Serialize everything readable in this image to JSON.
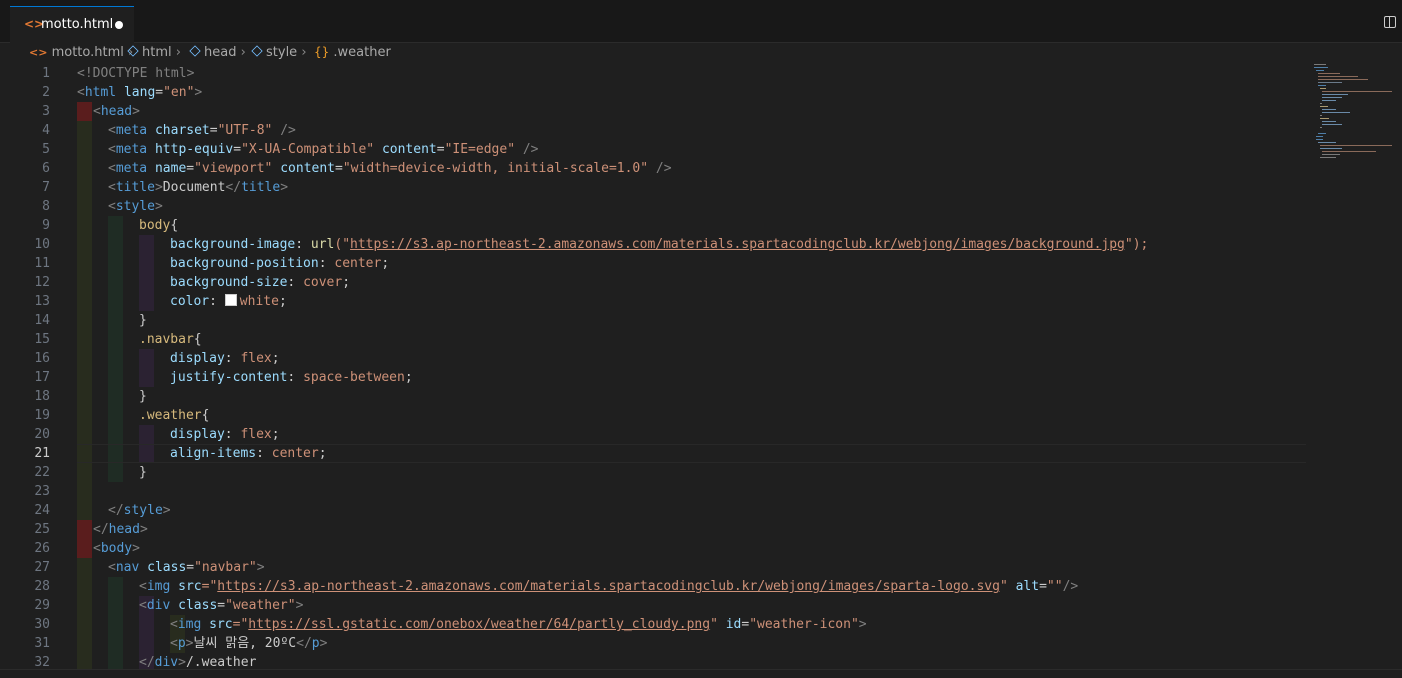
{
  "tab": {
    "title": "motto.html",
    "icon": "html-file-icon"
  },
  "breadcrumb": {
    "file": "motto.html",
    "items": [
      "html",
      "head",
      "style"
    ],
    "last": ".weather"
  },
  "editor": {
    "active_line": 21
  },
  "lines": [
    {
      "n": "1"
    },
    {
      "n": "2"
    },
    {
      "n": "3"
    },
    {
      "n": "4"
    },
    {
      "n": "5"
    },
    {
      "n": "6"
    },
    {
      "n": "7"
    },
    {
      "n": "8"
    },
    {
      "n": "9"
    },
    {
      "n": "10"
    },
    {
      "n": "11"
    },
    {
      "n": "12"
    },
    {
      "n": "13"
    },
    {
      "n": "14"
    },
    {
      "n": "15"
    },
    {
      "n": "16"
    },
    {
      "n": "17"
    },
    {
      "n": "18"
    },
    {
      "n": "19"
    },
    {
      "n": "20"
    },
    {
      "n": "21"
    },
    {
      "n": "22"
    },
    {
      "n": "23"
    },
    {
      "n": "24"
    },
    {
      "n": "25"
    },
    {
      "n": "26"
    },
    {
      "n": "27"
    },
    {
      "n": "28"
    },
    {
      "n": "29"
    },
    {
      "n": "30"
    },
    {
      "n": "31"
    },
    {
      "n": "32"
    }
  ],
  "code": {
    "l1": {
      "a": "<!DOCTYPE html>"
    },
    "l2": {
      "a": "<",
      "b": "html",
      "c": " lang",
      "d": "=",
      "e": "\"en\"",
      "f": ">"
    },
    "l3": {
      "a": "<",
      "b": "head",
      "c": ">"
    },
    "l4": {
      "a": "<",
      "b": "meta",
      "c": " charset",
      "d": "=",
      "e": "\"UTF-8\"",
      "f": " />"
    },
    "l5": {
      "a": "<",
      "b": "meta",
      "c": " http-equiv",
      "d": "=",
      "e": "\"X-UA-Compatible\"",
      "f": " content",
      "g": "=",
      "h": "\"IE=edge\"",
      "i": " />"
    },
    "l6": {
      "a": "<",
      "b": "meta",
      "c": " name",
      "d": "=",
      "e": "\"viewport\"",
      "f": " content",
      "g": "=",
      "h": "\"width=device-width, initial-scale=1.0\"",
      "i": " />"
    },
    "l7": {
      "a": "<",
      "b": "title",
      "c": ">",
      "d": "Document",
      "e": "</",
      "f": "title",
      "g": ">"
    },
    "l8": {
      "a": "<",
      "b": "style",
      "c": ">"
    },
    "l9": {
      "a": "body",
      "b": "{"
    },
    "l10": {
      "a": "background-image",
      "b": ": ",
      "c": "url",
      "d": "(\"",
      "e": "https://s3.ap-northeast-2.amazonaws.com/materials.spartacodingclub.kr/webjong/images/background.jpg",
      "f": "\");"
    },
    "l11": {
      "a": "background-position",
      "b": ": ",
      "c": "center",
      "d": ";"
    },
    "l12": {
      "a": "background-size",
      "b": ": ",
      "c": "cover",
      "d": ";"
    },
    "l13": {
      "a": "color",
      "b": ": ",
      "c": "white",
      "d": ";"
    },
    "l14": {
      "a": "}"
    },
    "l15": {
      "a": ".navbar",
      "b": "{"
    },
    "l16": {
      "a": "display",
      "b": ": ",
      "c": "flex",
      "d": ";"
    },
    "l17": {
      "a": "justify-content",
      "b": ": ",
      "c": "space-between",
      "d": ";"
    },
    "l18": {
      "a": "}"
    },
    "l19": {
      "a": ".weather",
      "b": "{"
    },
    "l20": {
      "a": "display",
      "b": ": ",
      "c": "flex",
      "d": ";"
    },
    "l21": {
      "a": "align-items",
      "b": ": ",
      "c": "center",
      "d": ";"
    },
    "l22": {
      "a": "}"
    },
    "l24": {
      "a": "</",
      "b": "style",
      "c": ">"
    },
    "l25": {
      "a": "</",
      "b": "head",
      "c": ">"
    },
    "l26": {
      "a": "<",
      "b": "body",
      "c": ">"
    },
    "l27": {
      "a": "<",
      "b": "nav",
      "c": " class",
      "d": "=",
      "e": "\"navbar\"",
      "f": ">"
    },
    "l28": {
      "a": "<",
      "b": "img",
      "c": " src",
      "d": "=\"",
      "e": "https://s3.ap-northeast-2.amazonaws.com/materials.spartacodingclub.kr/webjong/images/sparta-logo.svg",
      "f": "\"",
      "g": " alt",
      "h": "=",
      "i": "\"\"",
      "j": "/>"
    },
    "l29": {
      "a": "<",
      "b": "div",
      "c": " class",
      "d": "=",
      "e": "\"weather\"",
      "f": ">"
    },
    "l30": {
      "a": "<",
      "b": "img",
      "c": " src",
      "d": "=\"",
      "e": "https://ssl.gstatic.com/onebox/weather/64/partly_cloudy.png",
      "f": "\"",
      "g": " id",
      "h": "=",
      "i": "\"weather-icon\"",
      "j": ">"
    },
    "l31": {
      "a": "<",
      "b": "p",
      "c": ">",
      "d": "날씨 맑음, 20ºC",
      "e": "</",
      "f": "p",
      "g": ">"
    },
    "l32": {
      "a": "</",
      "b": "div",
      "c": ">",
      "d": "/.weather"
    }
  }
}
